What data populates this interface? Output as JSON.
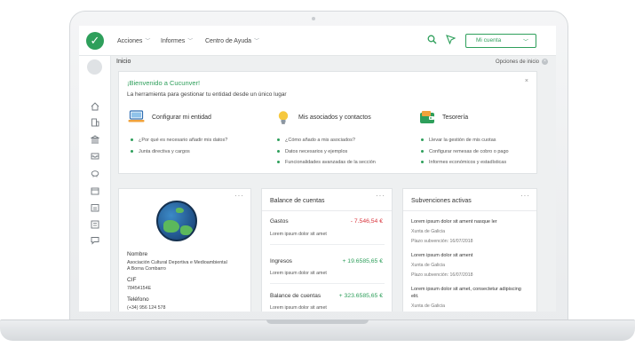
{
  "topbar": {
    "logo_glyph": "✓",
    "nav": [
      {
        "label": "Acciones"
      },
      {
        "label": "Informes"
      },
      {
        "label": "Centro de Ayuda"
      }
    ],
    "account_label": "Mi cuenta",
    "icons": [
      "search-icon",
      "filter-icon"
    ]
  },
  "breadcrumb": {
    "title": "Inicio",
    "options_label": "Opciones de inicio"
  },
  "sidebar": {
    "icons": [
      "home-icon",
      "building-icon",
      "bank-icon",
      "inbox-icon",
      "piggy-bank-icon",
      "calendar-icon",
      "calendar-list-icon",
      "list-icon",
      "chat-icon"
    ]
  },
  "welcome": {
    "title": "¡Bienvenido a Cucunver!",
    "subtitle": "La herramienta para gestionar tu entidad desde un único lugar",
    "close_glyph": "×",
    "columns": [
      {
        "title": "Configurar mi entidad",
        "icon": "laptop-icon",
        "items": [
          "¿Por qué es necesario añadir mis datos?",
          "Junta directiva y cargos"
        ]
      },
      {
        "title": "Mis asociados y contactos",
        "icon": "lightbulb-icon",
        "items": [
          "¿Cómo añado a mis asociados?",
          "Datos necesarios y ejemplos",
          "Funcionalidades avanzadas de la sección"
        ]
      },
      {
        "title": "Tesorería",
        "icon": "wallet-icon",
        "items": [
          "Llevar la gestión de mis cuotas",
          "Configurar remesas de cobro o pago",
          "Informes económicos y estadísticas"
        ]
      }
    ]
  },
  "entity_card": {
    "menu_glyph": "···",
    "nombre_label": "Nombre",
    "nombre_value_1": "Asociación Cultural Deportiva e Medioambiental",
    "nombre_value_2": "A Borna Combarro",
    "cif_label": "CIF",
    "cif_value": "78454154E",
    "telefono_label": "Teléfono",
    "telefono_value": "(+34) 956 124 578"
  },
  "balance_card": {
    "title": "Balance de cuentas",
    "menu_glyph": "···",
    "rows": [
      {
        "label": "Gastos",
        "value": "- 7.546,54 €",
        "sub": "Lorem ipsum dolor sit amet"
      },
      {
        "label": "Ingresos",
        "value": "+ 19.6585,65 €",
        "sub": "Lorem ipsum dolor sit amet"
      },
      {
        "label": "Balance de cuentas",
        "value": "+ 323.6585,65 €",
        "sub": "Lorem ipsum dolor sit amet"
      }
    ],
    "colors": {
      "negative": "#d9363e",
      "positive": "#2e9f5b"
    }
  },
  "subsidies_card": {
    "title": "Subvenciones activas",
    "menu_glyph": "···",
    "items": [
      {
        "title": "Lorem ipsum dolor sit ament nasque ler",
        "org": "Xunta de Galicia",
        "deadline": "Plazo subvención: 16/07/2018"
      },
      {
        "title": "Lorem ipsum dolor sit ament",
        "org": "Xunta de Galicia",
        "deadline": "Plazo subvención: 16/07/2018"
      },
      {
        "title": "Lorem ipsum dolor sit amet, consectetur adipiscing elit.",
        "org": "Xunta de Galicia",
        "deadline": ""
      }
    ]
  },
  "colors": {
    "accent": "#2e9f5b"
  }
}
